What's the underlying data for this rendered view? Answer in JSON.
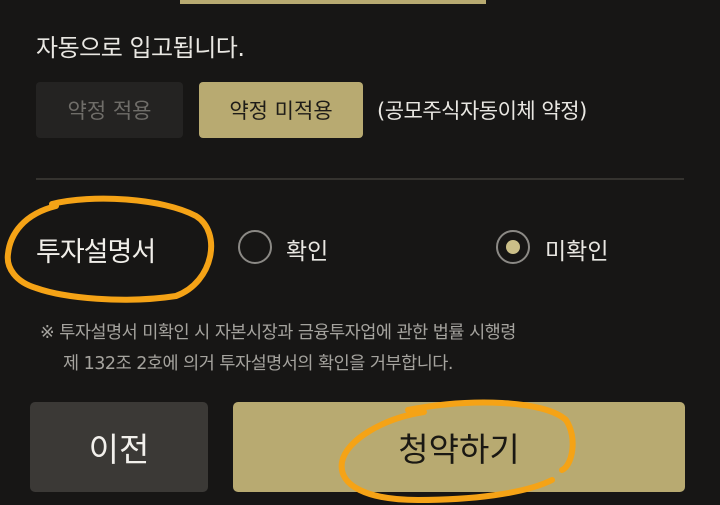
{
  "auto_deposit_text": "자동으로 입고됩니다.",
  "agreement": {
    "apply_label": "약정 적용",
    "not_apply_label": "약정 미적용",
    "selected": "약정 미적용",
    "note": "(공모주식자동이체 약정)"
  },
  "prospectus": {
    "label": "투자설명서",
    "options": [
      "확인",
      "미확인"
    ],
    "selected": "미확인"
  },
  "legal_note": {
    "line1": "※ 투자설명서 미확인 시 자본시장과 금융투자업에 관한 법률 시행령",
    "line2": "제 132조 2호에 의거 투자설명서의 확인을 거부합니다."
  },
  "buttons": {
    "prev_label": "이전",
    "subscribe_label": "청약하기"
  },
  "colors": {
    "accent": "#b8aa71",
    "background": "#171615",
    "highlight_marker": "#f5a316"
  }
}
